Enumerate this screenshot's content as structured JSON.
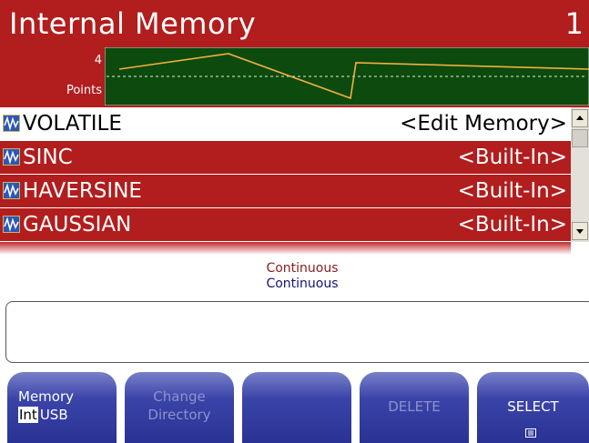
{
  "header": {
    "title": "Internal Memory",
    "channel": "1",
    "points_value": "4",
    "points_label": "Points"
  },
  "list": {
    "items": [
      {
        "name": "VOLATILE",
        "tag": "<Edit Memory>",
        "selected": true,
        "icon": "waveform-icon"
      },
      {
        "name": "SINC",
        "tag": "<Built-In>",
        "selected": false,
        "icon": "waveform-icon"
      },
      {
        "name": "HAVERSINE",
        "tag": "<Built-In>",
        "selected": false,
        "icon": "waveform-icon"
      },
      {
        "name": "GAUSSIAN",
        "tag": "<Built-In>",
        "selected": false,
        "icon": "waveform-icon"
      }
    ]
  },
  "status": {
    "line1": "Continuous",
    "line2": "Continuous"
  },
  "softkeys": {
    "memory": {
      "label": "Memory",
      "opt_int": "Int",
      "opt_usb": "USB"
    },
    "change_directory": {
      "line1": "Change",
      "line2": "Directory",
      "enabled": false
    },
    "blank": {
      "label": ""
    },
    "delete": {
      "label": "DELETE",
      "enabled": false
    },
    "select": {
      "label": "SELECT",
      "icon": "select-icon"
    }
  },
  "colors": {
    "header_red": "#b21d1d",
    "preview_bg": "#0d4a0d",
    "trace": "#f0b040",
    "softkey_blue": "#2a3294"
  }
}
